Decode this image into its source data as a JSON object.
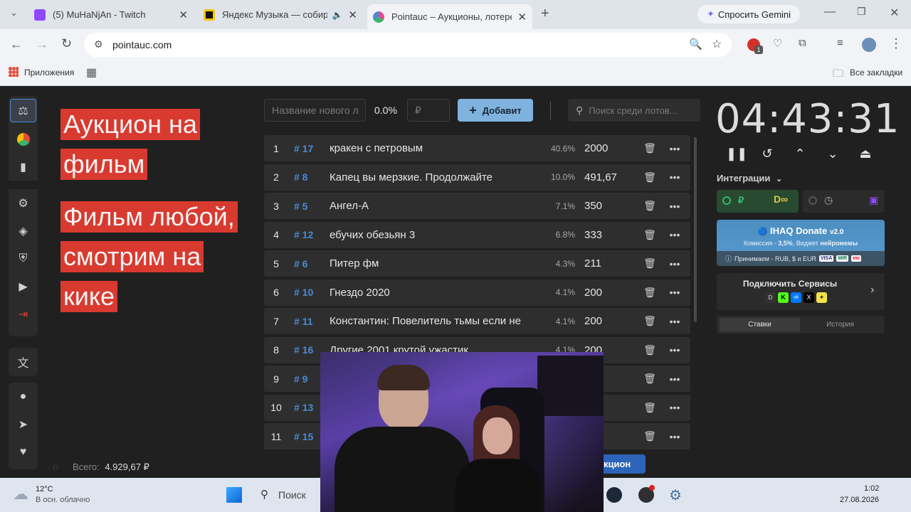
{
  "browser": {
    "tabs": [
      {
        "label": "(5) MuHaNjAn - Twitch",
        "color": "#9146ff"
      },
      {
        "label": "Яндекс Музыка — собирае",
        "color": "#f4c400"
      },
      {
        "label": "Pointauc – Аукционы, лотереи",
        "color": "#e34b8f"
      }
    ],
    "gemini_label": "Спросить Gemini",
    "url": "pointauc.com",
    "ext_badge": "1",
    "bookmarks_apps": "Приложения",
    "bookmarks_all": "Все закладки"
  },
  "overlay": {
    "line1a": "Аукцион на",
    "line1b": "фильм",
    "line2a": "Фильм любой,",
    "line2b": "смотрим на",
    "line2c": "кике"
  },
  "controls": {
    "name_placeholder": "Название нового л",
    "percent": "0.0%",
    "amount_placeholder": "₽",
    "add_label": "Добавит",
    "search_placeholder": "Поиск среди лотов..."
  },
  "lots": [
    {
      "n": "1",
      "id": "# 17",
      "name": "кракен с петровым",
      "pct": "40.6%",
      "amount": "2000"
    },
    {
      "n": "2",
      "id": "# 8",
      "name": "Капец вы мерзкие. Продолжайте",
      "pct": "10.0%",
      "amount": "491,67"
    },
    {
      "n": "3",
      "id": "# 5",
      "name": " Ангел-А",
      "pct": "7.1%",
      "amount": "350"
    },
    {
      "n": "4",
      "id": "# 12",
      "name": "ебучих обезьян 3",
      "pct": "6.8%",
      "amount": "333"
    },
    {
      "n": "5",
      "id": "# 6",
      "name": "Питер фм",
      "pct": "4.3%",
      "amount": "211"
    },
    {
      "n": "6",
      "id": "# 10",
      "name": "Гнездо 2020",
      "pct": "4.1%",
      "amount": "200"
    },
    {
      "n": "7",
      "id": "# 11",
      "name": "Константин: Повелитель тьмы если не",
      "pct": "4.1%",
      "amount": "200"
    },
    {
      "n": "8",
      "id": "# 16",
      "name": "Другие 2001 крутой ужастик",
      "pct": "4.1%",
      "amount": "200"
    },
    {
      "n": "9",
      "id": "# 9",
      "name": "",
      "pct": "",
      "amount": ""
    },
    {
      "n": "10",
      "id": "# 13",
      "name": "",
      "pct": "",
      "amount": ""
    },
    {
      "n": "11",
      "id": "# 15",
      "name": "",
      "pct": "",
      "amount": ""
    }
  ],
  "total_label": "Всего:",
  "total_value": "4.929,67 ₽",
  "start_partial": "укцион",
  "timer": "04:43:31",
  "integrations_label": "Интеграции",
  "donate": {
    "title": "IHAQ Donate",
    "version": "v2.0",
    "subtitle_pre": "Комиссия - ",
    "subtitle_pct": "3,5%",
    "subtitle_mid": ", Виджет ",
    "subtitle_bold": "нейромемы",
    "accepts": "Принимаем - RUB, $ и EUR",
    "cards": [
      "VISA",
      "MIR",
      "mc"
    ]
  },
  "connect_label": "Подключить Сервисы",
  "tabs_panel": {
    "bids": "Ставки",
    "history": "История"
  },
  "taskbar": {
    "temp": "12°C",
    "weather": "В осн. облачно",
    "search": "Поиск",
    "time": "1:02",
    "date": "27.08.2026"
  }
}
